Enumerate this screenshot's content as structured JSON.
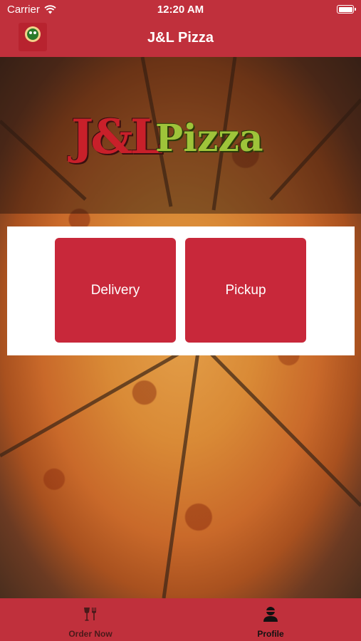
{
  "status_bar": {
    "carrier": "Carrier",
    "time": "12:20 AM"
  },
  "nav": {
    "title": "J&L Pizza",
    "logo_text": "J&L Pizza"
  },
  "hero": {
    "logo_jl": "J&L",
    "logo_pizza": "Pizza"
  },
  "actions": {
    "delivery_label": "Delivery",
    "pickup_label": "Pickup"
  },
  "tabs": [
    {
      "label": "Order Now",
      "icon": "utensils-icon"
    },
    {
      "label": "Profile",
      "icon": "person-icon"
    }
  ],
  "colors": {
    "brand_red": "#c0303c",
    "button_red": "#c8283a",
    "logo_green": "#9ec43a"
  }
}
